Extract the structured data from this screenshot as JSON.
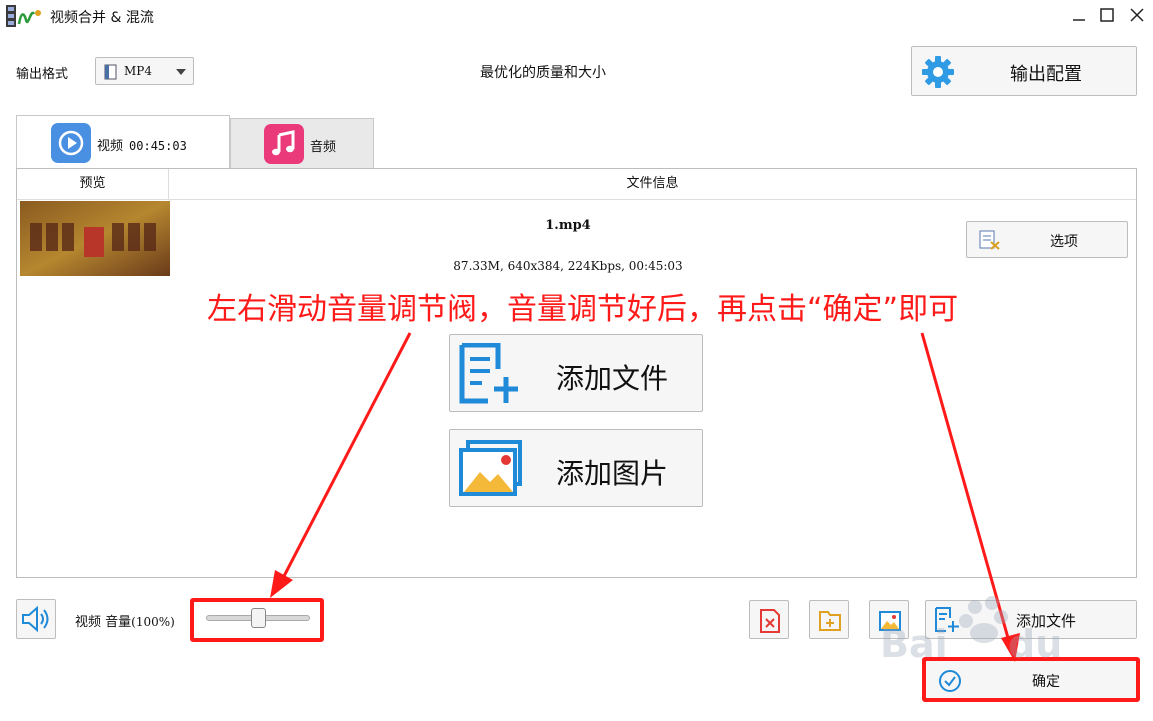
{
  "window": {
    "title": "视频合并 & 混流"
  },
  "format": {
    "label": "输出格式",
    "value": "MP4"
  },
  "quality_text": "最优化的质量和大小",
  "output_config": {
    "label": "输出配置"
  },
  "tabs": [
    {
      "label": "视频",
      "duration": "00:45:03"
    },
    {
      "label": "音频"
    }
  ],
  "table": {
    "headers": [
      "预览",
      "文件信息"
    ],
    "rows": [
      {
        "name": "1.mp4",
        "meta": "87.33M, 640x384, 224Kbps, 00:45:03"
      }
    ]
  },
  "options_button": {
    "label": "选项"
  },
  "annotation": "左右滑动音量调节阀，音量调节好后，再点击“确定”即可",
  "add_file_big": {
    "label": "添加文件"
  },
  "add_image_big": {
    "label": "添加图片"
  },
  "volume": {
    "label": "视频 音量",
    "percent_text": "(100%)",
    "value_fraction": 0.5
  },
  "bottom_toolbar": {
    "add_file_label": "添加文件"
  },
  "confirm": {
    "label": "确定"
  },
  "colors": {
    "annotation_red": "#ff1a1a",
    "accent_blue": "#1f8ad8",
    "audio_pink": "#ea3a7a",
    "gear_blue": "#2f9be4"
  },
  "icons": [
    "app-icon",
    "minimize-icon",
    "maximize-icon",
    "close-icon",
    "file-icon",
    "chevron-down-icon",
    "gear-icon",
    "play-icon",
    "music-note-icon",
    "options-icon",
    "add-file-icon",
    "add-image-icon",
    "speaker-icon",
    "remove-file-icon",
    "add-folder-icon",
    "image-icon",
    "clock-check-icon"
  ]
}
